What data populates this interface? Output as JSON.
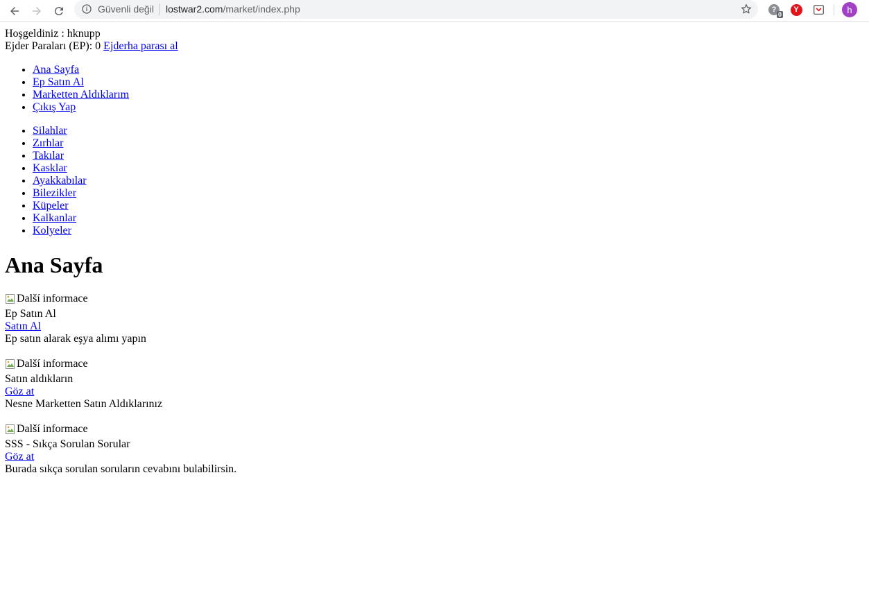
{
  "browser": {
    "security_label": "Güvenli değil",
    "url_host": "lostwar2.com",
    "url_path": "/market/index.php",
    "ext_badge": "0",
    "ext_y_letter": "Y",
    "profile_initial": "h"
  },
  "header": {
    "welcome_label": "Hoşgeldiniz : hknupp",
    "ep_label": "Ejder Paraları (EP): 0",
    "ep_link": "Ejderha parası al"
  },
  "nav_main": [
    {
      "label": "Ana Sayfa"
    },
    {
      "label": "Ep Satın Al"
    },
    {
      "label": "Marketten Aldıklarım"
    },
    {
      "label": "Çıkış Yap"
    }
  ],
  "nav_categories": [
    {
      "label": "Silahlar"
    },
    {
      "label": "Zırhlar"
    },
    {
      "label": "Takılar"
    },
    {
      "label": "Kasklar"
    },
    {
      "label": "Ayakkabılar"
    },
    {
      "label": "Bilezikler"
    },
    {
      "label": "Küpeler"
    },
    {
      "label": "Kalkanlar"
    },
    {
      "label": "Kolyeler"
    }
  ],
  "main": {
    "title": "Ana Sayfa",
    "cards": [
      {
        "img_alt": "Další informace",
        "title": "Ep Satın Al",
        "link": "Satın Al",
        "desc": "Ep satın alarak eşya alımı yapın"
      },
      {
        "img_alt": "Další informace",
        "title": "Satın aldıkların",
        "link": "Göz at",
        "desc": "Nesne Marketten Satın Aldıklarınız"
      },
      {
        "img_alt": "Další informace",
        "title": "SSS - Sıkça Sorulan Sorular",
        "link": "Göz at",
        "desc": "Burada sıkça sorulan soruların cevabını bulabilirsin."
      }
    ]
  }
}
